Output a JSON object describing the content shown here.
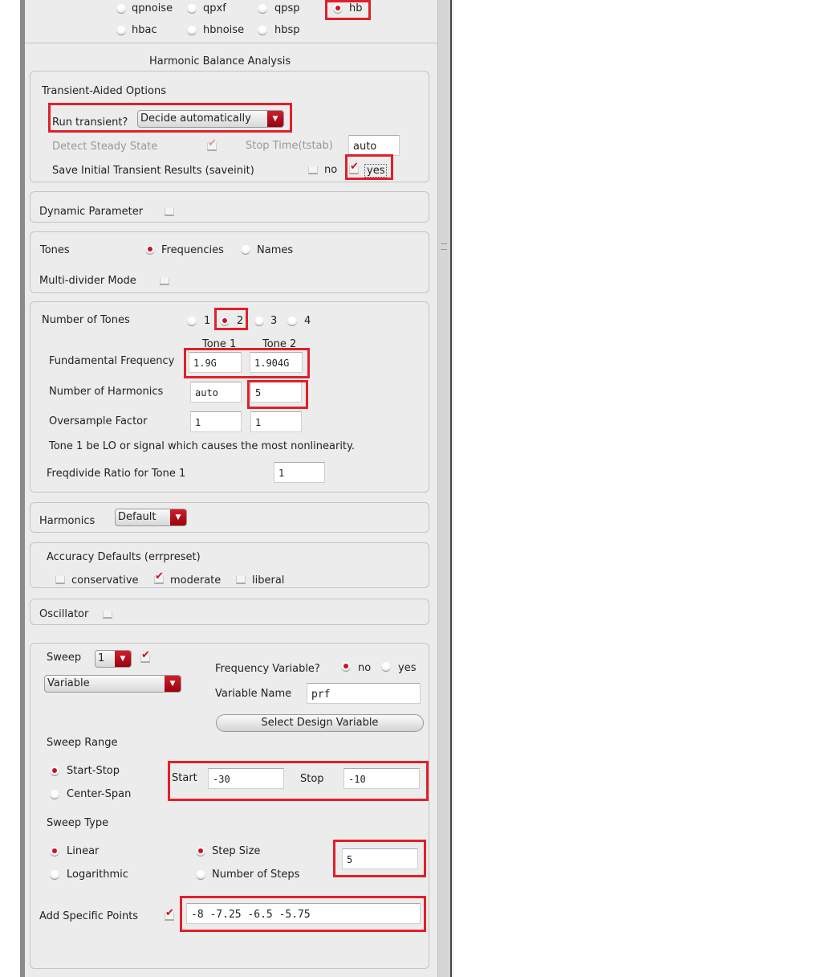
{
  "analysis_types": {
    "qpnoise": "qpnoise",
    "qpxf": "qpxf",
    "qpsp": "qpsp",
    "hb": "hb",
    "hbac": "hbac",
    "hbnoise": "hbnoise",
    "hbsp": "hbsp",
    "selected": "hb"
  },
  "title": "Harmonic Balance Analysis",
  "transient": {
    "heading": "Transient-Aided Options",
    "run_label": "Run transient?",
    "run_value": "Decide automatically",
    "detect_label": "Detect Steady State",
    "stop_label": "Stop Time(tstab)",
    "stop_value": "auto",
    "save_label": "Save Initial Transient Results (saveinit)",
    "no": "no",
    "yes": "yes"
  },
  "dynamic": {
    "label": "Dynamic Parameter"
  },
  "tones": {
    "label": "Tones",
    "frequencies": "Frequencies",
    "names": "Names",
    "multidivider": "Multi-divider Mode"
  },
  "num_tones": {
    "label": "Number of Tones",
    "options": [
      "1",
      "2",
      "3",
      "4"
    ],
    "selected": "2",
    "tone1": "Tone 1",
    "tone2": "Tone 2",
    "fund_label": "Fundamental Frequency",
    "fund": [
      "1.9G",
      "1.904G"
    ],
    "harm_label": "Number of Harmonics",
    "harm": [
      "auto",
      "5"
    ],
    "over_label": "Oversample Factor",
    "over": [
      "1",
      "1"
    ],
    "note": "Tone 1 be LO or signal which causes the most nonlinearity.",
    "freqdiv_label": "Freqdivide Ratio for Tone 1",
    "freqdiv": "1"
  },
  "harmonics": {
    "label": "Harmonics",
    "value": "Default"
  },
  "accuracy": {
    "label": "Accuracy Defaults (errpreset)",
    "conservative": "conservative",
    "moderate": "moderate",
    "liberal": "liberal"
  },
  "oscillator": {
    "label": "Oscillator"
  },
  "sweep": {
    "label": "Sweep",
    "count": "1",
    "type": "Variable",
    "freqvar_label": "Frequency Variable?",
    "no": "no",
    "yes": "yes",
    "varname_label": "Variable Name",
    "varname": "prf",
    "select_btn": "Select Design Variable",
    "range_label": "Sweep Range",
    "startstop": "Start-Stop",
    "centerspan": "Center-Span",
    "start_label": "Start",
    "start": "-30",
    "stop_label": "Stop",
    "stop": "-10",
    "type_label": "Sweep Type",
    "linear": "Linear",
    "log": "Logarithmic",
    "stepsize": "Step Size",
    "numsteps": "Number of Steps",
    "step": "5",
    "specific_label": "Add Specific Points",
    "specific": "-8 -7.25 -6.5 -5.75"
  },
  "colors": {
    "accent": "#d0101a",
    "highlight": "#e0202a"
  }
}
